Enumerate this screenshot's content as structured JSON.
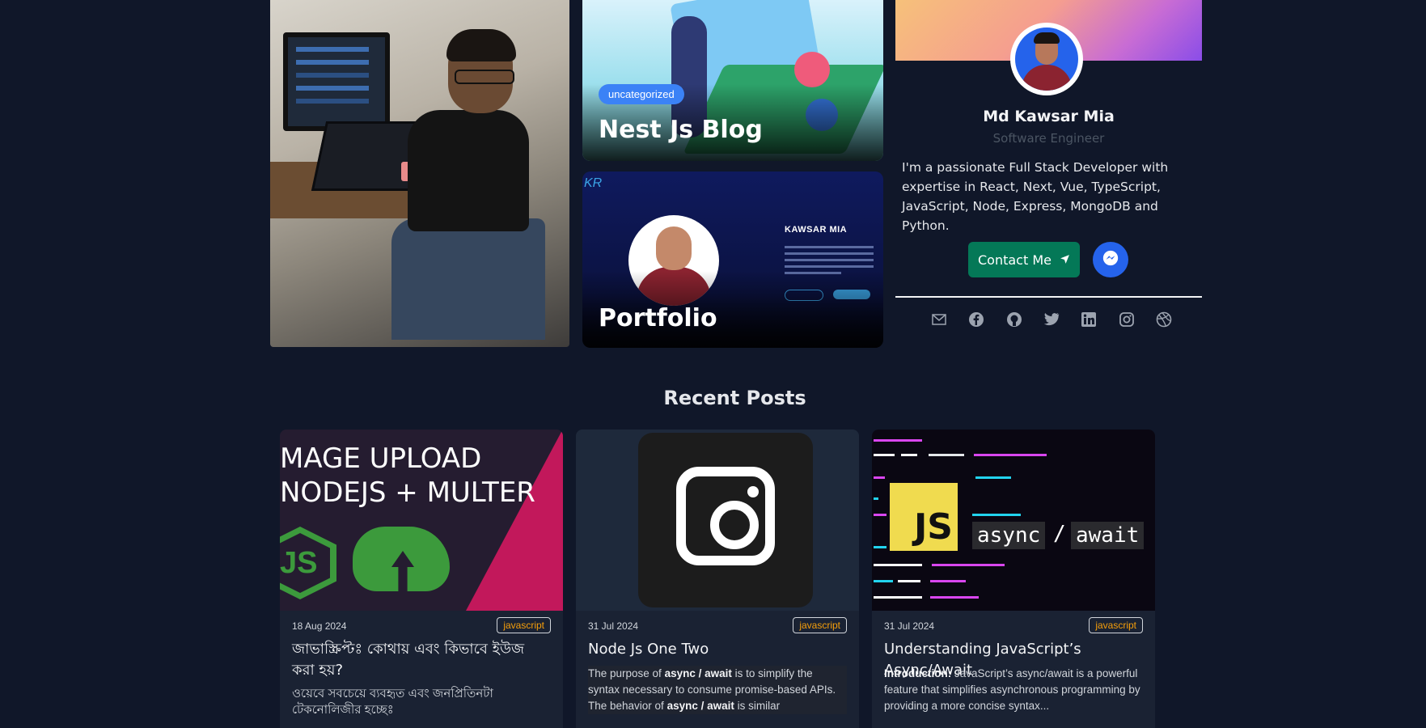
{
  "features": [
    {
      "badge": "uncategorized",
      "title": "Nest Js Blog"
    },
    {
      "title": "Portfolio",
      "preview_name": "KAWSAR MIA",
      "preview_logo": "KR"
    }
  ],
  "profile": {
    "name": "Md Kawsar Mia",
    "role": "Software Engineer",
    "bio": "I'm a passionate Full Stack Developer with expertise in React, Next, Vue, TypeScript, JavaScript, Node, Express, MongoDB and Python.",
    "contact_label": "Contact Me",
    "social_icons": [
      "mail-icon",
      "facebook-icon",
      "github-icon",
      "twitter-icon",
      "linkedin-icon",
      "instagram-icon",
      "dribbble-icon"
    ]
  },
  "recent": {
    "title": "Recent Posts",
    "posts": [
      {
        "date": "18 Aug 2024",
        "tag": "javascript",
        "title": "জাভাস্ক্রিপ্টঃ কোথায় এবং কিভাবে ইউজ করা হয়?",
        "excerpt": "ওয়েবে সবচেয়ে ব্যবহৃত এবং জনপ্রিতিনটা টেকনোলিজীর হচ্ছেঃ",
        "image_text": [
          "MAGE UPLOAD",
          "NODEJS + MULTER"
        ]
      },
      {
        "date": "31 Jul 2024",
        "tag": "javascript",
        "title": "Node Js One Two",
        "excerpt_parts": [
          "The purpose of ",
          "async / await",
          " is to simplify the syntax necessary to consume promise-based APIs. The behavior of ",
          "async / await",
          " is similar"
        ]
      },
      {
        "date": "31 Jul 2024",
        "tag": "javascript",
        "title": "Understanding JavaScript’s Async/Await",
        "excerpt_lead": "Introduction:",
        "excerpt_rest": " JavaScript’s async/await is a powerful feature that simplifies asynchronous programming by providing a more concise syntax...",
        "image_text": [
          "JS",
          "async",
          "/",
          "await"
        ]
      }
    ]
  },
  "colors": {
    "background": "#101729",
    "card": "#1a2233",
    "contact_button": "#047857",
    "messenger_button": "#2563eb",
    "tag_text": "#f59e0b",
    "badge": "#3b82f6"
  }
}
